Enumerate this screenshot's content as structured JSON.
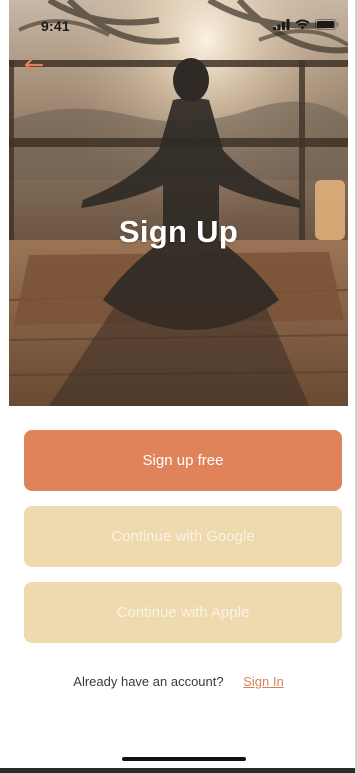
{
  "status_bar": {
    "time": "9:41",
    "icons": [
      "cellular-signal-icon",
      "wifi-icon",
      "battery-icon"
    ]
  },
  "nav": {
    "back_icon": "arrow-left-icon"
  },
  "hero": {
    "title": "Sign Up",
    "image": "yoga-meditation-photo"
  },
  "buttons": {
    "sign_up_free": "Sign up free",
    "google": "Continue with Google",
    "apple": "Continue with Apple"
  },
  "footer": {
    "prompt": "Already have an account?",
    "sign_in_link": "Sign In"
  },
  "colors": {
    "accent": "#e0835a",
    "secondary_button": "#efd9ae",
    "link": "#d9825d"
  }
}
